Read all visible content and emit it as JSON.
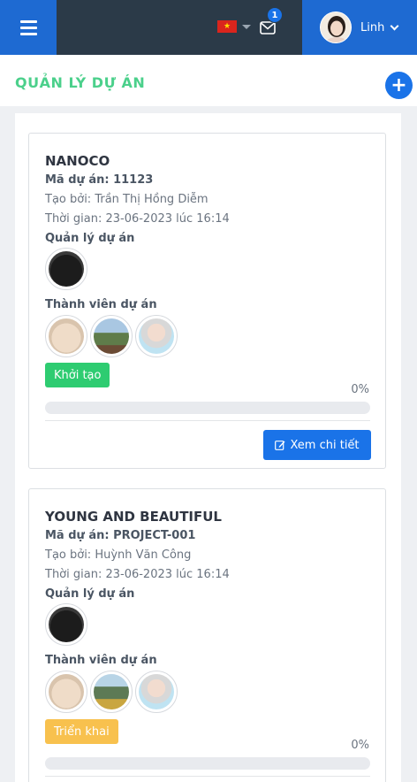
{
  "header": {
    "language_flag": "vietnam-flag-icon",
    "notification_count": "1",
    "user_name": "Linh"
  },
  "page": {
    "title": "QUẢN LÝ DỰ ÁN"
  },
  "labels": {
    "manager": "Quản lý dự án",
    "members": "Thành viên dự án",
    "detail_button": "Xem chi tiết"
  },
  "colors": {
    "primary": "#1a73e8",
    "title_green": "#4bd08b",
    "status_init": "#2ecc71",
    "status_deploy": "#f8c14e"
  },
  "projects": [
    {
      "name": "NANOCO",
      "code_line": "Mã dự án: 11123",
      "created_by": "Tạo bởi: Trần Thị Hồng Diễm",
      "time": "Thời gian: 23-06-2023 lúc 16:14",
      "status": "Khởi tạo",
      "progress_text": "0%",
      "progress": 0
    },
    {
      "name": "YOUNG AND BEAUTIFUL",
      "code_line": "Mã dự án: PROJECT-001",
      "created_by": "Tạo bởi: Huỳnh Văn Công",
      "time": "Thời gian: 23-06-2023 lúc 16:14",
      "status": "Triển khai",
      "progress_text": "0%",
      "progress": 0
    }
  ]
}
